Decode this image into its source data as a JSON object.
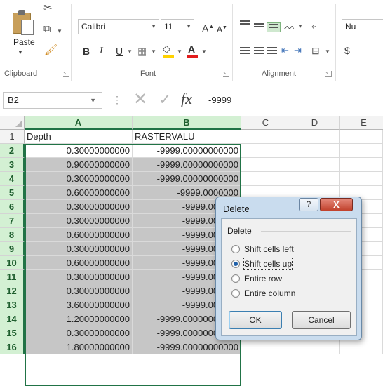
{
  "ribbon": {
    "groups": [
      {
        "name": "Clipboard"
      },
      {
        "name": "Font"
      },
      {
        "name": "Alignment"
      }
    ],
    "paste_label": "Paste",
    "font_name": "Calibri",
    "font_size": "11",
    "bold": "B",
    "italic": "I",
    "underline": "U",
    "grow": "A",
    "shrink": "A",
    "font_color": "A",
    "number_label": "Nu",
    "currency": "$"
  },
  "formula_bar": {
    "name_box": "B2",
    "fx": "fx",
    "value": "-9999"
  },
  "columns": [
    "A",
    "B",
    "C",
    "D",
    "E"
  ],
  "rows": [
    {
      "n": "1",
      "a": "Depth",
      "b": "RASTERVALU"
    },
    {
      "n": "2",
      "a": "0.30000000000",
      "b": "-9999.00000000000"
    },
    {
      "n": "3",
      "a": "0.90000000000",
      "b": "-9999.00000000000"
    },
    {
      "n": "4",
      "a": "0.30000000000",
      "b": "-9999.00000000000"
    },
    {
      "n": "5",
      "a": "0.60000000000",
      "b": "-9999.0000000"
    },
    {
      "n": "6",
      "a": "0.30000000000",
      "b": "-9999.000000"
    },
    {
      "n": "7",
      "a": "0.30000000000",
      "b": "-9999.000000"
    },
    {
      "n": "8",
      "a": "0.60000000000",
      "b": "-9999.000000"
    },
    {
      "n": "9",
      "a": "0.30000000000",
      "b": "-9999.000000"
    },
    {
      "n": "10",
      "a": "0.60000000000",
      "b": "-9999.000000"
    },
    {
      "n": "11",
      "a": "0.30000000000",
      "b": "-9999.000000"
    },
    {
      "n": "12",
      "a": "0.30000000000",
      "b": "-9999.000000"
    },
    {
      "n": "13",
      "a": "3.60000000000",
      "b": "-9999.000000"
    },
    {
      "n": "14",
      "a": "1.20000000000",
      "b": "-9999.00000000000"
    },
    {
      "n": "15",
      "a": "0.30000000000",
      "b": "-9999.00000000000"
    },
    {
      "n": "16",
      "a": "1.80000000000",
      "b": "-9999.00000000000"
    }
  ],
  "dialog": {
    "title": "Delete",
    "group": "Delete",
    "help": "?",
    "close": "X",
    "options": [
      {
        "label": "Shift cells left",
        "selected": false
      },
      {
        "label": "Shift cells up",
        "selected": true
      },
      {
        "label": "Entire row",
        "selected": false
      },
      {
        "label": "Entire column",
        "selected": false
      }
    ],
    "ok": "OK",
    "cancel": "Cancel"
  },
  "colors": {
    "accent": "#217346",
    "selection_fill": "#c6c6c6",
    "dialog_frame": "#c9dcee"
  }
}
